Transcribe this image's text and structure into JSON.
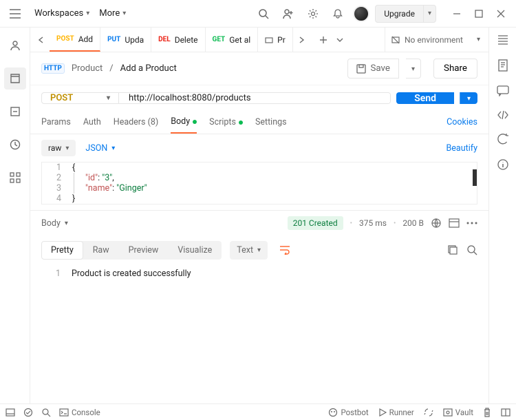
{
  "topbar": {
    "workspaces": "Workspaces",
    "more": "More",
    "upgrade": "Upgrade"
  },
  "tabs": [
    {
      "method": "POST",
      "label": "Add",
      "cls": "m-post",
      "active": true
    },
    {
      "method": "PUT",
      "label": "Upda",
      "cls": "m-put",
      "active": false
    },
    {
      "method": "DEL",
      "label": "Delete",
      "cls": "m-del",
      "active": false
    },
    {
      "method": "GET",
      "label": "Get al",
      "cls": "m-get",
      "active": false
    },
    {
      "method": "",
      "label": "Pr",
      "cls": "",
      "active": false,
      "icon": true
    }
  ],
  "environment": "No environment",
  "breadcrumb": {
    "badge": "HTTP",
    "parent": "Product",
    "current": "Add a Product"
  },
  "actions": {
    "save": "Save",
    "share": "Share"
  },
  "request": {
    "method": "POST",
    "url": "http://localhost:8080/products",
    "send": "Send"
  },
  "subtabs": {
    "params": "Params",
    "auth": "Auth",
    "headers": "Headers (8)",
    "body": "Body",
    "scripts": "Scripts",
    "settings": "Settings",
    "cookies": "Cookies"
  },
  "bodytype": {
    "raw": "raw",
    "json": "JSON",
    "beautify": "Beautify"
  },
  "editor": {
    "lines": [
      "1",
      "2",
      "3",
      "4"
    ],
    "l1": "{",
    "l2_key": "\"id\"",
    "l2_val": "\"3\"",
    "l3_key": "\"name\"",
    "l3_val": "\"Ginger\"",
    "l4": "}"
  },
  "response": {
    "body_label": "Body",
    "status": "201 Created",
    "time": "375 ms",
    "size": "200 B",
    "views": {
      "pretty": "Pretty",
      "raw": "Raw",
      "preview": "Preview",
      "visualize": "Visualize"
    },
    "format": "Text",
    "line1": "1",
    "text": "Product is created successfully"
  },
  "statusbar": {
    "console": "Console",
    "postbot": "Postbot",
    "runner": "Runner",
    "vault": "Vault"
  }
}
